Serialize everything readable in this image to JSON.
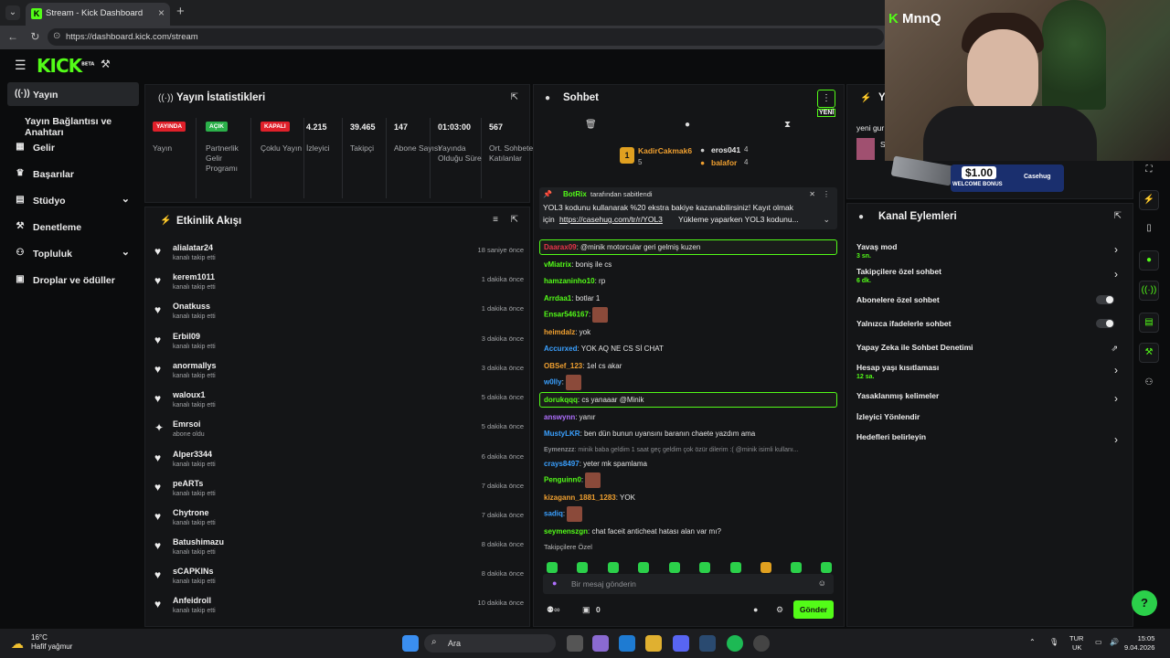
{
  "browser": {
    "tab_title": "Stream - Kick Dashboard",
    "url": "https://dashboard.kick.com/stream"
  },
  "brand": {
    "logo": "KICK",
    "logo_suffix": "BETA",
    "accent": "#53fc18"
  },
  "sidebar": {
    "items": [
      {
        "label": "Yayın",
        "icon": "stream-icon"
      },
      {
        "label": "Yayın Bağlantısı ve Anahtarı",
        "icon": ""
      },
      {
        "label": "Gelir",
        "icon": "revenue-icon"
      },
      {
        "label": "Başarılar",
        "icon": "trophy-icon"
      },
      {
        "label": "Stüdyo",
        "icon": "studio-icon"
      },
      {
        "label": "Denetleme",
        "icon": "moderation-icon"
      },
      {
        "label": "Topluluk",
        "icon": "community-icon"
      },
      {
        "label": "Droplar ve ödüller",
        "icon": "drops-icon"
      }
    ]
  },
  "stats": {
    "title": "Yayın İstatistikleri",
    "columns": [
      {
        "badge": "YAYINDA",
        "badge_color": "#e0202a",
        "label": "Yayın"
      },
      {
        "badge": "AÇIK",
        "badge_color": "#2bb04a",
        "label": "Partnerlik Gelir Programı"
      },
      {
        "badge": "KAPALI",
        "badge_color": "#e0202a",
        "label": "Çoklu Yayın"
      },
      {
        "value": "4.215",
        "label": "İzleyici"
      },
      {
        "value": "39.465",
        "label": "Takipçi"
      },
      {
        "value": "147",
        "label": "Abone Sayısı"
      },
      {
        "value": "01:03:00",
        "label": "Yayında Olduğu Süre"
      },
      {
        "value": "567",
        "label": "Ort. Sohbete Katılanlar"
      }
    ]
  },
  "activity": {
    "title": "Etkinlik Akışı",
    "items": [
      {
        "name": "alialatar24",
        "sub": "kanalı takip etti",
        "time": "18 saniye önce",
        "icon": "heart-icon"
      },
      {
        "name": "kerem1011",
        "sub": "kanalı takip etti",
        "time": "1 dakika önce",
        "icon": "heart-icon"
      },
      {
        "name": "Onatkuss",
        "sub": "kanalı takip etti",
        "time": "1 dakika önce",
        "icon": "heart-icon"
      },
      {
        "name": "Erbil09",
        "sub": "kanalı takip etti",
        "time": "3 dakika önce",
        "icon": "heart-icon"
      },
      {
        "name": "anormallys",
        "sub": "kanalı takip etti",
        "time": "3 dakika önce",
        "icon": "heart-icon"
      },
      {
        "name": "waloux1",
        "sub": "kanalı takip etti",
        "time": "5 dakika önce",
        "icon": "heart-icon"
      },
      {
        "name": "Emrsoi",
        "sub": "abone oldu",
        "time": "5 dakika önce",
        "icon": "star-icon"
      },
      {
        "name": "Alper3344",
        "sub": "kanalı takip etti",
        "time": "6 dakika önce",
        "icon": "heart-icon"
      },
      {
        "name": "peARTs",
        "sub": "kanalı takip etti",
        "time": "7 dakika önce",
        "icon": "heart-icon"
      },
      {
        "name": "Chytrone",
        "sub": "kanalı takip etti",
        "time": "7 dakika önce",
        "icon": "heart-icon"
      },
      {
        "name": "Batushimazu",
        "sub": "kanalı takip etti",
        "time": "8 dakika önce",
        "icon": "heart-icon"
      },
      {
        "name": "sCAPKINs",
        "sub": "kanalı takip etti",
        "time": "8 dakika önce",
        "icon": "heart-icon"
      },
      {
        "name": "Anfeidroll",
        "sub": "kanalı takip etti",
        "time": "10 dakika önce",
        "icon": "heart-icon"
      }
    ]
  },
  "chat": {
    "title": "Sohbet",
    "new_badge": "YENİ",
    "gifters": [
      {
        "name": "KadirCakmak6",
        "count": "5"
      },
      {
        "name": "eros041",
        "count": "4"
      },
      {
        "name": "balafor",
        "count": "4"
      }
    ],
    "pinned": {
      "by": "BotRix",
      "by_suffix": "tarafından sabitlendi",
      "text1": "YOL3 kodunu kullanarak %20 ekstra bakiye kazanabilirsiniz! Kayıt olmak",
      "text2_prefix": "için",
      "link": "https://casehug.com/tr/r/YOL3",
      "text2_suffix": "Yükleme yaparken YOL3 kodunu..."
    },
    "messages": [
      {
        "user": "Daarax09",
        "color": "#e8344a",
        "text": ": @minik motorcular geri gelmiş kuzen",
        "highlight": true
      },
      {
        "user": "vMiatrix",
        "color": "#53fc18",
        "text": ": boniş ile cs"
      },
      {
        "user": "hamzaninho10",
        "color": "#53fc18",
        "text": ": rp"
      },
      {
        "user": "Arrdaa1",
        "color": "#53fc18",
        "text": ": botlar 1"
      },
      {
        "user": "Ensar546167",
        "color": "#53fc18",
        "text": ":",
        "emote": true
      },
      {
        "user": "heimdalz",
        "color": "#f0a030",
        "text": ": yok"
      },
      {
        "user": "Accurxed",
        "color": "#3aa0ff",
        "text": ": YOK AQ NE CS Sİ CHAT"
      },
      {
        "user": "OBSef_123",
        "color": "#f0a030",
        "text": ": 1el cs akar"
      },
      {
        "user": "w0lly",
        "color": "#3aa0ff",
        "text": ":",
        "emote": true
      },
      {
        "user": "dorukqqq",
        "color": "#53fc18",
        "text": ": cs yanaaar @Minik",
        "highlight": true
      },
      {
        "user": "answynn",
        "color": "#b070ff",
        "text": ": yanır"
      },
      {
        "user": "MustyLKR",
        "color": "#3aa0ff",
        "text": ": ben dün bunun uyansını baranın chaete yazdım ama"
      },
      {
        "user": "Eymenzzz",
        "color": "#8a8c90",
        "text": ": minik baba geldim 1 saat geç geldim çok özür dilerim :( @minik isimli kullanı..."
      },
      {
        "user": "crays8497",
        "color": "#3aa0ff",
        "text": ": yeter mk spamlama"
      },
      {
        "user": "Penguinn0",
        "color": "#53fc18",
        "text": ":",
        "emote": true
      },
      {
        "user": "kizagann_1881_1283",
        "color": "#f0a030",
        "text": ": YOK"
      },
      {
        "user": "sadiq",
        "color": "#3aa0ff",
        "text": ":",
        "emote": true
      },
      {
        "user": "seymenszgn",
        "color": "#53fc18",
        "text": ": chat faceit anticheat hatası alan var mı?"
      }
    ],
    "follower_only": "Takipçilere Özel",
    "input_placeholder": "Bir mesaj gönderin",
    "footer_count": "0",
    "send_label": "Gönder"
  },
  "right_top": {
    "title": "Ya",
    "item": "yeni gur",
    "item2": "Sa"
  },
  "actions": {
    "title": "Kanal Eylemleri",
    "rows": [
      {
        "label": "Yavaş mod",
        "sub": "3 sn.",
        "control": "chevron"
      },
      {
        "label": "Takipçilere özel sohbet",
        "sub": "6 dk.",
        "control": "chevron"
      },
      {
        "label": "Abonelere özel sohbet",
        "sub": "",
        "control": "toggle"
      },
      {
        "label": "Yalnızca ifadelerle sohbet",
        "sub": "",
        "control": "toggle"
      },
      {
        "label": "Yapay Zeka ile Sohbet Denetimi",
        "sub": "",
        "control": "external"
      },
      {
        "label": "Hesap yaşı kısıtlaması",
        "sub": "12 sa.",
        "control": "chevron"
      },
      {
        "label": "Yasaklanmış kelimeler",
        "sub": "",
        "control": "chevron"
      },
      {
        "label": "İzleyici Yönlendir",
        "sub": "",
        "control": "none"
      },
      {
        "label": "Hedefleri belirleyin",
        "sub": "",
        "control": "chevron"
      }
    ]
  },
  "webcam": {
    "name": "MnnQ",
    "bonus_amount": "$1.00",
    "bonus_label": "WELCOME BONUS",
    "bonus_brand": "Casehug"
  },
  "taskbar": {
    "temp": "16°C",
    "weather": "Hafif yağmur",
    "search": "Ara",
    "lang1": "TUR",
    "lang2": "UK",
    "time": "15:05",
    "date": "9.04.2026"
  }
}
